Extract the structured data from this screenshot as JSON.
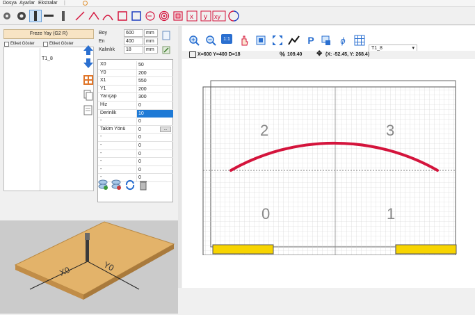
{
  "menu": {
    "dosya": "Dosya",
    "ayarlar": "Ayarlar",
    "ekstralar": "Ekstralar"
  },
  "left": {
    "panel_title": "Freze Yay (G2 R)",
    "show_label_1": "Etiket Göster",
    "show_label_2": "Etiket Göster",
    "tool_item": "T1_8"
  },
  "dims": {
    "boy": {
      "label": "Boy",
      "value": "600",
      "unit": "mm"
    },
    "en": {
      "label": "En",
      "value": "400",
      "unit": "mm"
    },
    "kalinlik": {
      "label": "Kalınlık",
      "value": "18",
      "unit": "mm"
    }
  },
  "params": [
    {
      "k": "X0",
      "v": "50"
    },
    {
      "k": "Y0",
      "v": "200"
    },
    {
      "k": "X1",
      "v": "550"
    },
    {
      "k": "Y1",
      "v": "200"
    },
    {
      "k": "Yarıçap",
      "v": "300"
    },
    {
      "k": "Hiz",
      "v": "0"
    },
    {
      "k": "Derinlik",
      "v": "10"
    },
    {
      "k": "-",
      "v": "0"
    },
    {
      "k": "Takim Yönü",
      "v": "0"
    },
    {
      "k": "-",
      "v": "0"
    },
    {
      "k": "-",
      "v": "0"
    },
    {
      "k": "-",
      "v": "0"
    },
    {
      "k": "-",
      "v": "0"
    },
    {
      "k": "-",
      "v": "0"
    },
    {
      "k": "-",
      "v": "0"
    }
  ],
  "browse_button": "...",
  "view3d": {
    "x_label": "X0",
    "y_label": "Y0"
  },
  "right": {
    "zoom_1to1": "1:1",
    "tool_select": "T1_8",
    "status_dims": "X=600 Y=400 D=18",
    "status_zoom": "109.40",
    "status_coords": "(X: -52.45, Y: 268.4)"
  },
  "canvas": {
    "quad0": "0",
    "quad1": "1",
    "quad2": "2",
    "quad3": "3"
  },
  "colors": {
    "arc": "#d4143c",
    "accent_blue": "#1e7ad6",
    "panel_head": "#f8e4c4",
    "clamp": "#f7d400"
  }
}
